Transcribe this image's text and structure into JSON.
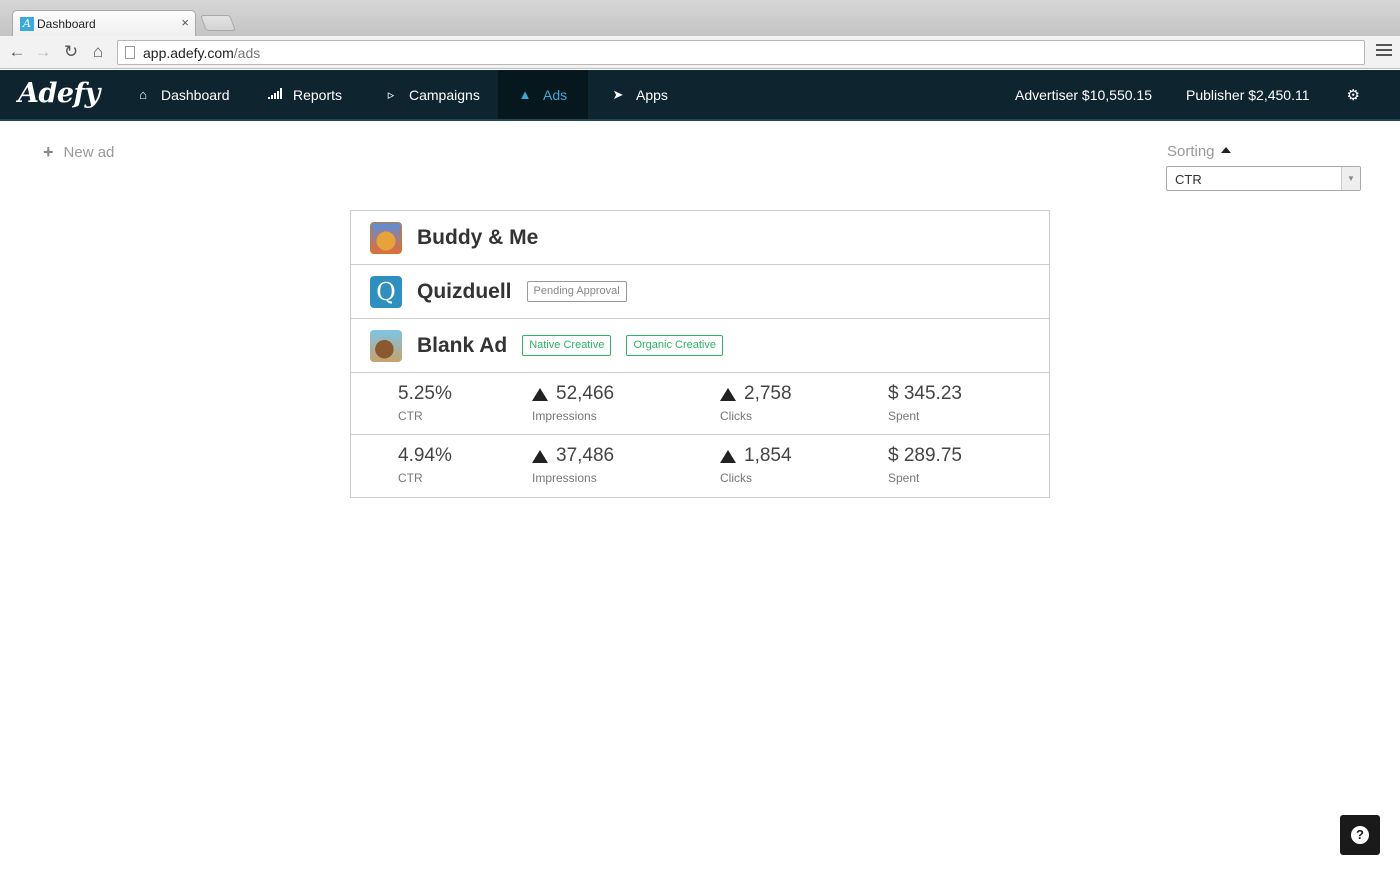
{
  "browser": {
    "tab_title": "Dashboard",
    "tab_favicon": "A",
    "tab_close": "×",
    "url_host": "app.adefy.com",
    "url_path": "/ads"
  },
  "nav": {
    "logo": "Adefy",
    "items": [
      {
        "label": "Dashboard",
        "icon": "home-icon"
      },
      {
        "label": "Reports",
        "icon": "signal-bars-icon"
      },
      {
        "label": "Campaigns",
        "icon": "bullhorn-icon"
      },
      {
        "label": "Ads",
        "icon": "sitemap-icon",
        "active": true
      },
      {
        "label": "Apps",
        "icon": "rocket-icon"
      }
    ],
    "advertiser_balance": "Advertiser $10,550.15",
    "publisher_balance": "Publisher $2,450.11"
  },
  "page": {
    "new_ad_label": "New ad",
    "sorting_label": "Sorting",
    "sorting_value": "CTR"
  },
  "ads": [
    {
      "name": "Buddy & Me",
      "badges": []
    },
    {
      "name": "Quizduell",
      "badges": [
        "Pending Approval"
      ]
    },
    {
      "name": "Blank Ad",
      "badges": [
        "Native Creative",
        "Organic Creative"
      ]
    }
  ],
  "stats": [
    {
      "ctr": "5.25%",
      "ctr_label": "CTR",
      "impressions": "52,466",
      "impressions_label": "Impressions",
      "clicks": "2,758",
      "clicks_label": "Clicks",
      "spent": "$ 345.23",
      "spent_label": "Spent"
    },
    {
      "ctr": "4.94%",
      "ctr_label": "CTR",
      "impressions": "37,486",
      "impressions_label": "Impressions",
      "clicks": "1,854",
      "clicks_label": "Clicks",
      "spent": "$ 289.75",
      "spent_label": "Spent"
    }
  ],
  "colors": {
    "nav_bg": "#0e2530",
    "accent": "#3aa9dc",
    "green": "#2db365"
  }
}
